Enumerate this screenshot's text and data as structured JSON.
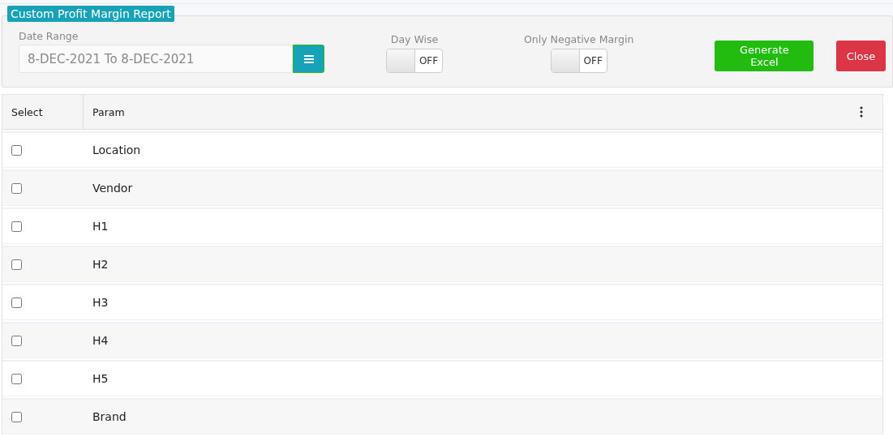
{
  "title": "Custom Profit Margin Report",
  "date_range": {
    "label": "Date Range",
    "value": "8-DEC-2021 To 8-DEC-2021"
  },
  "toggles": [
    {
      "label": "Day Wise",
      "on": false,
      "state_text": "OFF"
    },
    {
      "label": "Only Negative Margin",
      "on": false,
      "state_text": "OFF"
    }
  ],
  "buttons": [
    {
      "label": "Generate Excel",
      "kind": "primary"
    },
    {
      "label": "Close",
      "kind": "danger"
    }
  ],
  "table": {
    "columns": [
      "Select",
      "Param"
    ],
    "rows": [
      {
        "param": "Location",
        "checked": false
      },
      {
        "param": "Vendor",
        "checked": false
      },
      {
        "param": "H1",
        "checked": false
      },
      {
        "param": "H2",
        "checked": false
      },
      {
        "param": "H3",
        "checked": false
      },
      {
        "param": "H4",
        "checked": false
      },
      {
        "param": "H5",
        "checked": false
      },
      {
        "param": "Brand",
        "checked": false
      }
    ]
  }
}
